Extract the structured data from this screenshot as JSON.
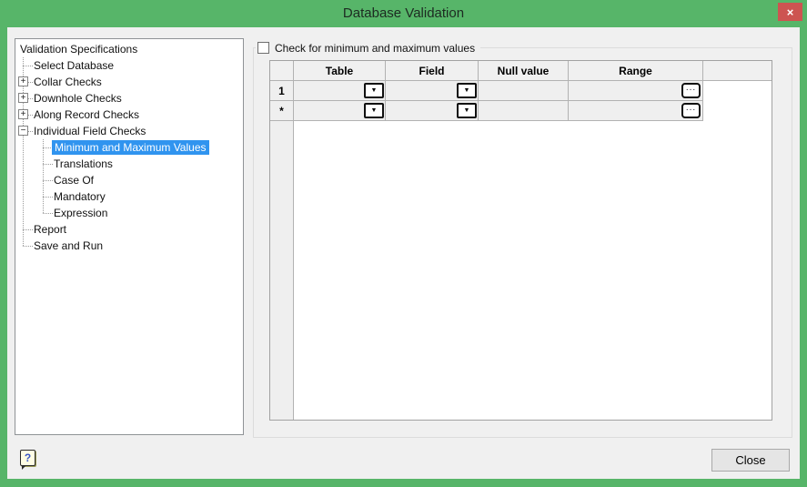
{
  "window": {
    "title": "Database Validation",
    "close_glyph": "×"
  },
  "tree": {
    "items": [
      {
        "label": "Validation Specifications",
        "level": 0
      },
      {
        "label": "Select Database",
        "level": 1
      },
      {
        "label": "Collar Checks",
        "level": 1,
        "glyph": "+"
      },
      {
        "label": "Downhole Checks",
        "level": 1,
        "glyph": "+"
      },
      {
        "label": "Along Record Checks",
        "level": 1,
        "glyph": "+"
      },
      {
        "label": "Individual Field Checks",
        "level": 1,
        "glyph": "−"
      },
      {
        "label": "Minimum and Maximum Values",
        "level": 2,
        "selected": true
      },
      {
        "label": "Translations",
        "level": 2
      },
      {
        "label": "Case Of",
        "level": 2
      },
      {
        "label": "Mandatory",
        "level": 2
      },
      {
        "label": "Expression",
        "level": 2
      },
      {
        "label": "Report",
        "level": 1
      },
      {
        "label": "Save and Run",
        "level": 1
      }
    ]
  },
  "panel": {
    "checkbox_label": "Check for minimum and maximum values",
    "checkbox_checked": false
  },
  "grid": {
    "columns": [
      "Table",
      "Field",
      "Null value",
      "Range"
    ],
    "rows": [
      {
        "header": "1",
        "table": "",
        "field": "",
        "null_value": "",
        "range": ""
      },
      {
        "header": "*",
        "table": "",
        "field": "",
        "null_value": "",
        "range": ""
      }
    ]
  },
  "icons": {
    "dropdown_arrow": "▼",
    "ellipsis": "...",
    "help_glyph": "?"
  },
  "footer": {
    "close_label": "Close"
  },
  "colors": {
    "titlebar": "#57b569",
    "close_red": "#cd5451",
    "selection": "#3094ef",
    "dialog_bg": "#f0f0f0",
    "grid_line": "#b2b2b2"
  }
}
